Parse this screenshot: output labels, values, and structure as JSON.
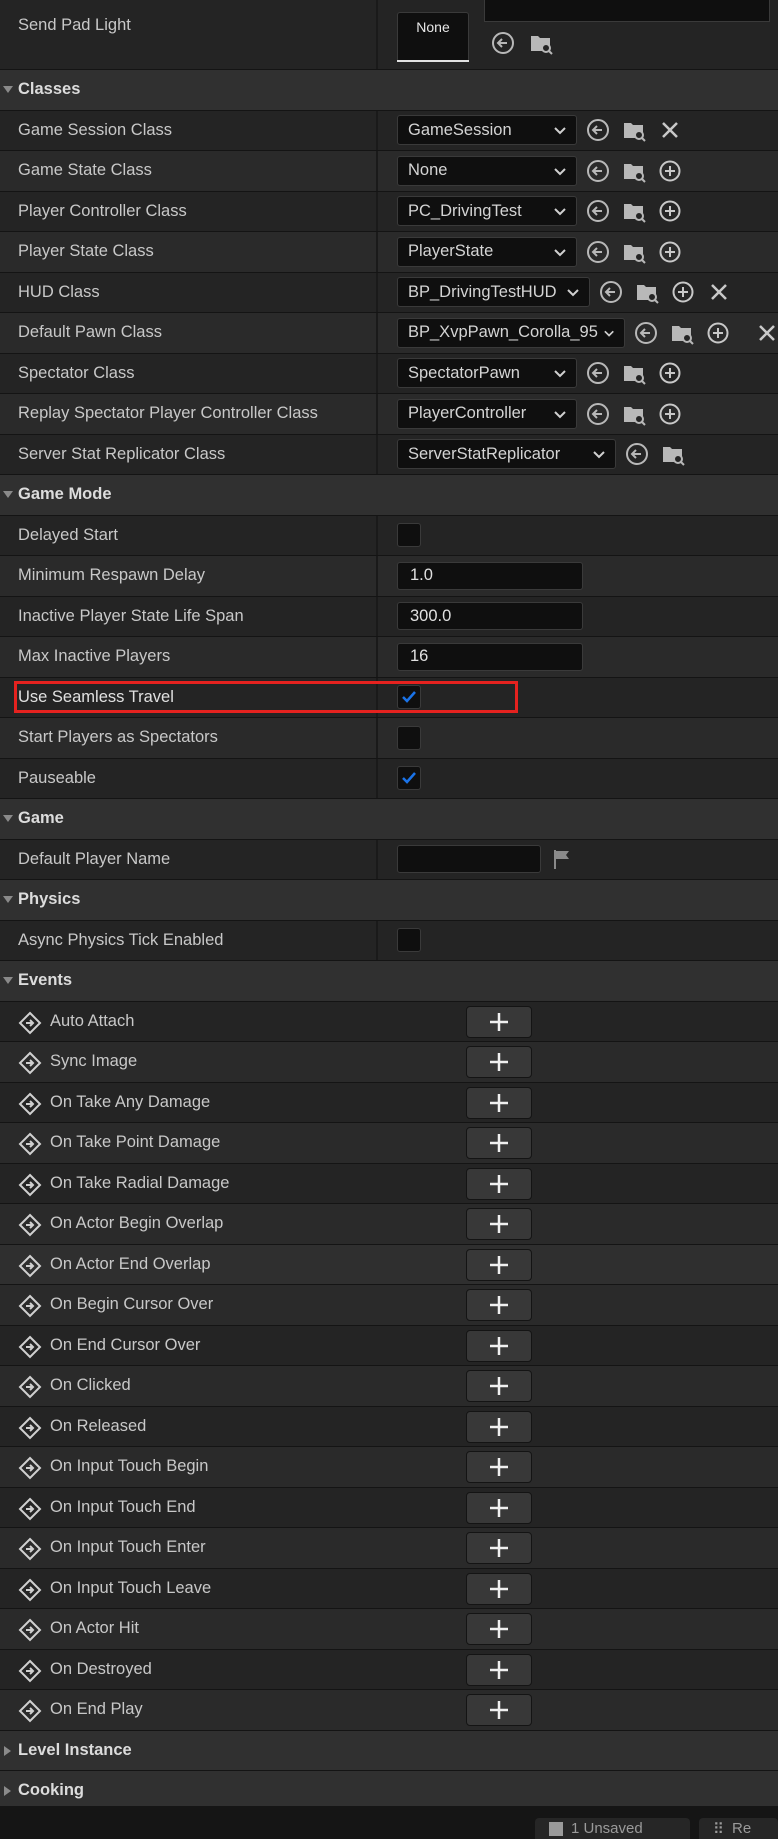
{
  "send_pad_light": {
    "label": "Send Pad Light",
    "value": "None"
  },
  "categories": {
    "classes": "Classes",
    "game_mode": "Game Mode",
    "game": "Game",
    "physics": "Physics",
    "events": "Events",
    "level_instance": "Level Instance",
    "cooking": "Cooking"
  },
  "classes": [
    {
      "label": "Game Session Class",
      "value": "GameSession"
    },
    {
      "label": "Game State Class",
      "value": "None"
    },
    {
      "label": "Player Controller Class",
      "value": "PC_DrivingTest"
    },
    {
      "label": "Player State Class",
      "value": "PlayerState"
    },
    {
      "label": "HUD Class",
      "value": "BP_DrivingTestHUD"
    },
    {
      "label": "Default Pawn Class",
      "value": "BP_XvpPawn_Corolla_95"
    },
    {
      "label": "Spectator Class",
      "value": "SpectatorPawn"
    },
    {
      "label": "Replay Spectator Player Controller Class",
      "value": "PlayerController"
    },
    {
      "label": "Server Stat Replicator Class",
      "value": "ServerStatReplicator"
    }
  ],
  "game_mode": {
    "delayed_start": {
      "label": "Delayed Start",
      "checked": false
    },
    "min_respawn_delay": {
      "label": "Minimum Respawn Delay",
      "value": "1.0"
    },
    "inactive_life_span": {
      "label": "Inactive Player State Life Span",
      "value": "300.0"
    },
    "max_inactive_players": {
      "label": "Max Inactive Players",
      "value": "16"
    },
    "use_seamless_travel": {
      "label": "Use Seamless Travel",
      "checked": true
    },
    "start_as_spectators": {
      "label": "Start Players as Spectators",
      "checked": false
    },
    "pauseable": {
      "label": "Pauseable",
      "checked": true
    }
  },
  "game": {
    "default_player_name": {
      "label": "Default Player Name",
      "value": ""
    }
  },
  "physics": {
    "async_tick": {
      "label": "Async Physics Tick Enabled",
      "checked": false
    }
  },
  "events": [
    "Auto Attach",
    "Sync Image",
    "On Take Any Damage",
    "On Take Point Damage",
    "On Take Radial Damage",
    "On Actor Begin Overlap",
    "On Actor End Overlap",
    "On Begin Cursor Over",
    "On End Cursor Over",
    "On Clicked",
    "On Released",
    "On Input Touch Begin",
    "On Input Touch End",
    "On Input Touch Enter",
    "On Input Touch Leave",
    "On Actor Hit",
    "On Destroyed",
    "On End Play"
  ],
  "statusbar": {
    "unsaved": "1 Unsaved",
    "revision": "Re"
  },
  "colors": {
    "accent": "#1a73e8",
    "highlight": "#e5221f",
    "text": "#c8c8c8"
  }
}
